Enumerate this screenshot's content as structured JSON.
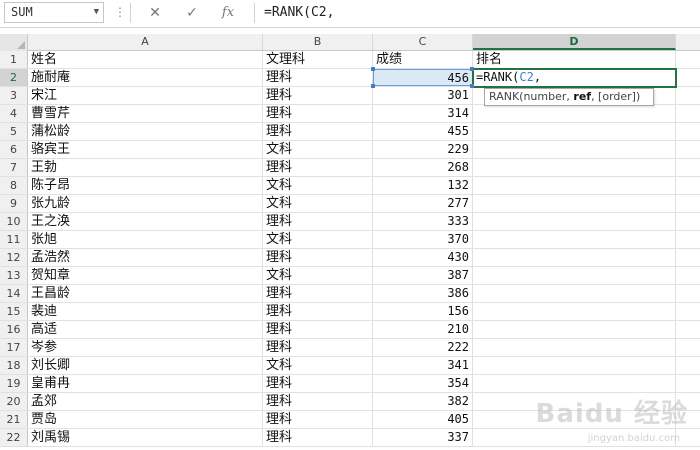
{
  "formula_bar": {
    "name_box": "SUM",
    "dots": "⋮",
    "cancel_icon": "✕",
    "enter_icon": "✓",
    "fx_label": "fx",
    "formula": "=RANK(C2,"
  },
  "columns": [
    "A",
    "B",
    "C",
    "D"
  ],
  "active_column": "D",
  "rows": [
    {
      "n": "1",
      "a": "姓名",
      "b": "文理科",
      "c": "成绩",
      "d": "排名"
    },
    {
      "n": "2",
      "a": "施耐庵",
      "b": "理科",
      "c": "456",
      "d": ""
    },
    {
      "n": "3",
      "a": "宋江",
      "b": "理科",
      "c": "301",
      "d": ""
    },
    {
      "n": "4",
      "a": "曹雪芹",
      "b": "理科",
      "c": "314",
      "d": ""
    },
    {
      "n": "5",
      "a": "蒲松龄",
      "b": "理科",
      "c": "455",
      "d": ""
    },
    {
      "n": "6",
      "a": "骆宾王",
      "b": "文科",
      "c": "229",
      "d": ""
    },
    {
      "n": "7",
      "a": "王勃",
      "b": "理科",
      "c": "268",
      "d": ""
    },
    {
      "n": "8",
      "a": "陈子昂",
      "b": "文科",
      "c": "132",
      "d": ""
    },
    {
      "n": "9",
      "a": "张九龄",
      "b": "文科",
      "c": "277",
      "d": ""
    },
    {
      "n": "10",
      "a": "王之涣",
      "b": "理科",
      "c": "333",
      "d": ""
    },
    {
      "n": "11",
      "a": "张旭",
      "b": "文科",
      "c": "370",
      "d": ""
    },
    {
      "n": "12",
      "a": "孟浩然",
      "b": "理科",
      "c": "430",
      "d": ""
    },
    {
      "n": "13",
      "a": "贺知章",
      "b": "文科",
      "c": "387",
      "d": ""
    },
    {
      "n": "14",
      "a": "王昌龄",
      "b": "理科",
      "c": "386",
      "d": ""
    },
    {
      "n": "15",
      "a": "裴迪",
      "b": "理科",
      "c": "156",
      "d": ""
    },
    {
      "n": "16",
      "a": "高适",
      "b": "理科",
      "c": "210",
      "d": ""
    },
    {
      "n": "17",
      "a": "岑参",
      "b": "理科",
      "c": "222",
      "d": ""
    },
    {
      "n": "18",
      "a": "刘长卿",
      "b": "文科",
      "c": "341",
      "d": ""
    },
    {
      "n": "19",
      "a": "皇甫冉",
      "b": "理科",
      "c": "354",
      "d": ""
    },
    {
      "n": "20",
      "a": "孟郊",
      "b": "理科",
      "c": "382",
      "d": ""
    },
    {
      "n": "21",
      "a": "贾岛",
      "b": "理科",
      "c": "405",
      "d": ""
    },
    {
      "n": "22",
      "a": "刘禹锡",
      "b": "理科",
      "c": "337",
      "d": ""
    }
  ],
  "editing_cell": {
    "prefix": "=RANK(",
    "ref": "C2",
    "suffix": ","
  },
  "tooltip": {
    "pre": "RANK(number, ",
    "bold": "ref",
    "post": ", [order])"
  },
  "watermark": {
    "main": "Baidu 经验",
    "sub": "jingyan.baidu.com"
  },
  "colors": {
    "accent_green": "#217346",
    "ref_blue": "#3f7fce",
    "selection_blue": "#dbe9f7"
  }
}
